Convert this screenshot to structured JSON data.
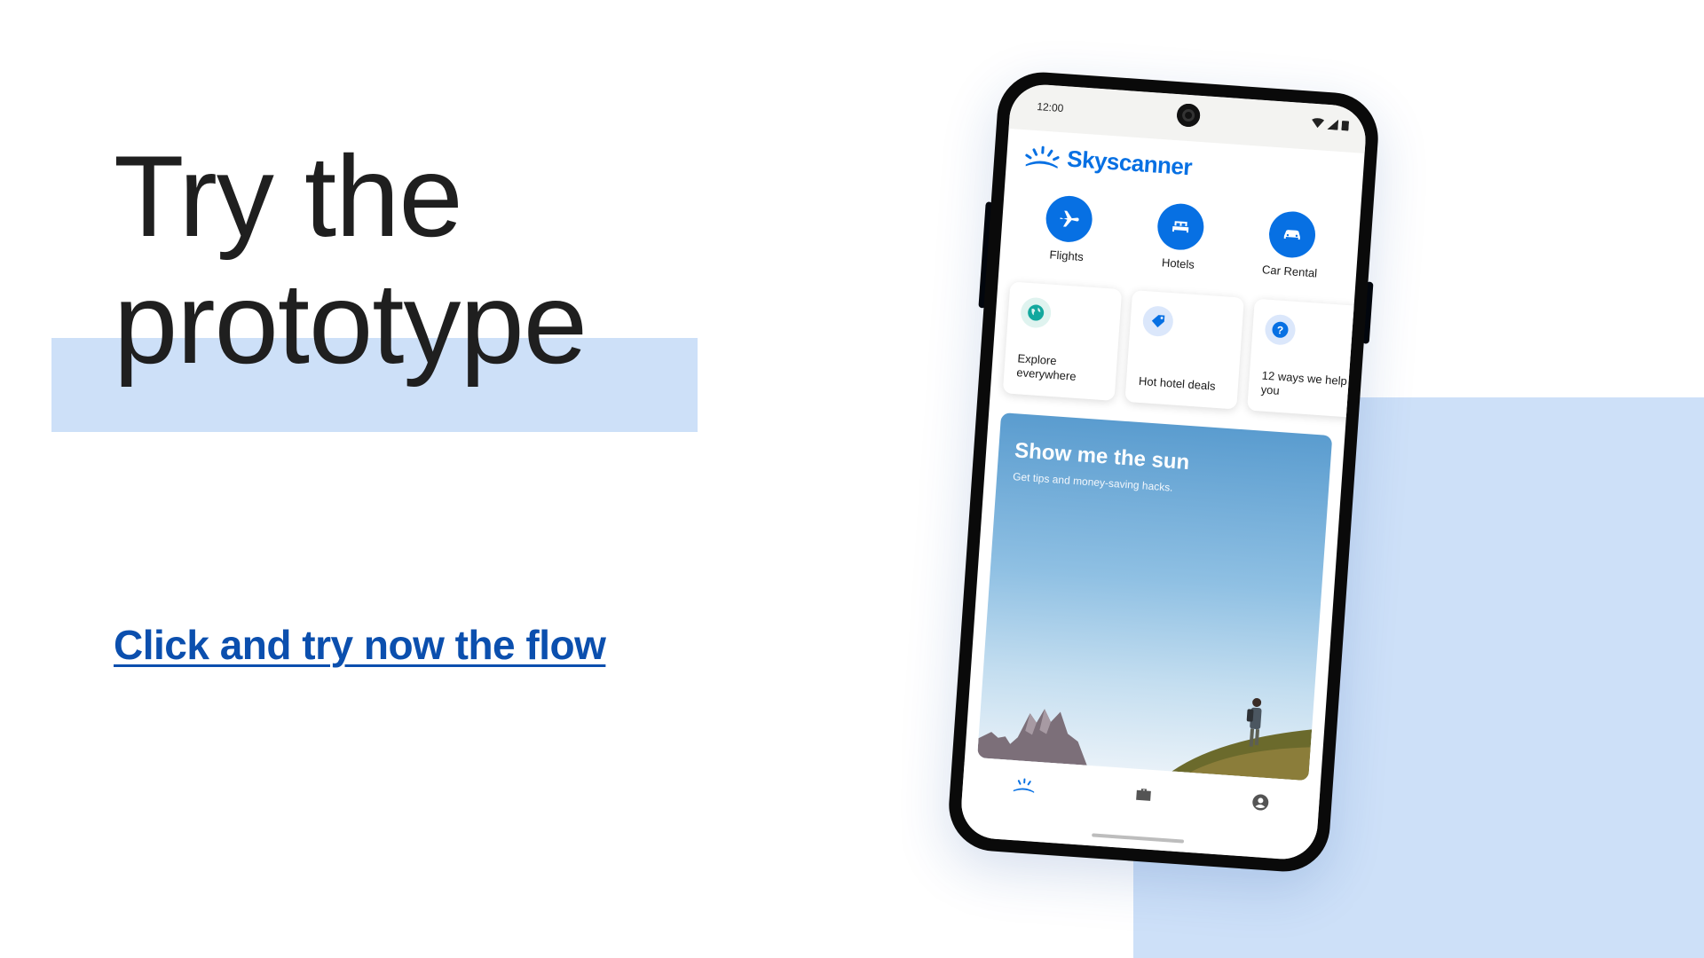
{
  "headline": {
    "line1": "Try the",
    "line2": "prototype"
  },
  "cta": {
    "label": "Click and try now the flow"
  },
  "phone": {
    "status": {
      "time": "12:00"
    },
    "brand": {
      "name": "Skyscanner",
      "logo_icon": "sunrise-icon"
    },
    "categories": [
      {
        "label": "Flights",
        "icon": "plane-icon"
      },
      {
        "label": "Hotels",
        "icon": "bed-icon"
      },
      {
        "label": "Car Rental",
        "icon": "car-icon"
      }
    ],
    "cards": [
      {
        "label": "Explore everywhere",
        "icon": "globe-icon"
      },
      {
        "label": "Hot hotel deals",
        "icon": "tag-icon"
      },
      {
        "label": "12 ways we help you",
        "icon": "question-icon"
      }
    ],
    "promo": {
      "title": "Show me the sun",
      "subtitle": "Get tips and money-saving hacks."
    },
    "nav": [
      {
        "name": "home",
        "icon": "sunrise-icon"
      },
      {
        "name": "trips",
        "icon": "briefcase-icon"
      },
      {
        "name": "profile",
        "icon": "profile-icon"
      }
    ]
  },
  "colors": {
    "brand_blue": "#0770e3",
    "highlight": "#cde0f8",
    "cta": "#0b4fae",
    "text": "#1f1f1f"
  }
}
